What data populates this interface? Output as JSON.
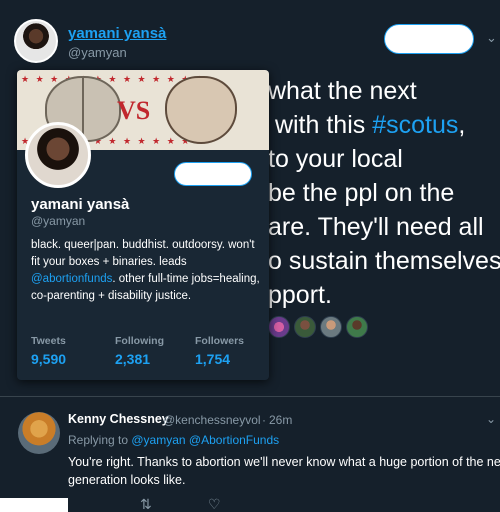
{
  "tweet": {
    "author_name": "yamani yansà",
    "author_handle": "@yamyan",
    "text_before_hashtag": "what the next\n with this ",
    "hashtag": "#scotus",
    "text_after_hashtag": ",\nto your local\nbe the ppl on the\nare. They'll need all\no sustain themselves\npport."
  },
  "profile_card": {
    "banner_text": "VS",
    "name": "yamani yansà",
    "handle": "@yamyan",
    "bio_part1": "black. queer|pan. buddhist. outdoorsy. won't fit your boxes + binaries. leads ",
    "bio_mention": "@abortionfunds",
    "bio_part2": ". other full-time jobs=healing, co-parenting + disability justice.",
    "stats": [
      {
        "label": "Tweets",
        "value": "9,590"
      },
      {
        "label": "Following",
        "value": "2,381"
      },
      {
        "label": "Followers",
        "value": "1,754"
      }
    ]
  },
  "reply": {
    "name": "Kenny Chessney",
    "handle": "@kenchessneyvol",
    "separator": "·",
    "time": "26m",
    "replying_label": "Replying to ",
    "replying_mention1": "@yamyan",
    "replying_mention2": "@AbortionFunds",
    "text": "You're right. Thanks to abortion we'll never know what a huge portion of the next\ngeneration looks like."
  },
  "icons": {
    "header_chevron": "chevron-down-icon",
    "reply_chevron": "chevron-down-icon",
    "retweet": "retweet-icon",
    "like": "heart-icon"
  },
  "colors": {
    "background": "#15202b",
    "card": "#192734",
    "accent": "#1da1f2",
    "muted": "#8899a6"
  }
}
